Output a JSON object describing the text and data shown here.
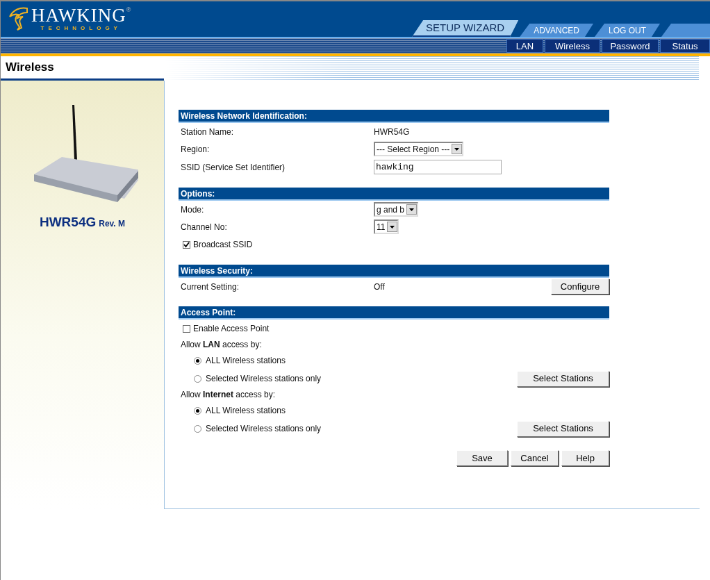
{
  "logo": {
    "name": "HAWKING",
    "mark": "®",
    "tagline": "TECHNOLOGY"
  },
  "main_tabs": [
    {
      "label": "SETUP WIZARD",
      "selected": true
    },
    {
      "label": "ADVANCED",
      "selected": false
    },
    {
      "label": "LOG OUT",
      "selected": false
    }
  ],
  "sub_nav": [
    "LAN",
    "Wireless",
    "Password",
    "Status"
  ],
  "page_title": "Wireless",
  "product": {
    "model": "HWR54G",
    "revision": "Rev. M"
  },
  "sections": [
    {
      "title": "Wireless Network Identification:",
      "rows": [
        {
          "kind": "text",
          "label": "Station Name:",
          "value": "HWR54G"
        },
        {
          "kind": "select",
          "label": "Region:",
          "value": "--- Select Region ---"
        },
        {
          "kind": "input",
          "label": "SSID (Service Set Identifier)",
          "value": "hawking"
        }
      ]
    },
    {
      "title": "Options:",
      "rows": [
        {
          "kind": "select",
          "label": "Mode:",
          "value": "g and b"
        },
        {
          "kind": "select",
          "label": "Channel No:",
          "value": "11"
        },
        {
          "kind": "checkbox",
          "label": "Broadcast SSID",
          "checked": true
        }
      ]
    },
    {
      "title": "Wireless Security:",
      "rows": [
        {
          "kind": "text",
          "label": "Current Setting:",
          "value": "Off",
          "button": "Configure"
        }
      ]
    },
    {
      "title": "Access Point:",
      "rows": [
        {
          "kind": "checkbox",
          "label": "Enable Access Point",
          "checked": false
        },
        {
          "kind": "label",
          "label": "Allow **LAN** access by:"
        },
        {
          "kind": "radio",
          "label": "ALL Wireless stations",
          "selected": true
        },
        {
          "kind": "radio",
          "label": "Selected Wireless stations only",
          "selected": false,
          "button": "Select Stations"
        },
        {
          "kind": "label",
          "label": "Allow **Internet** access by:"
        },
        {
          "kind": "radio",
          "label": "ALL Wireless stations",
          "selected": true
        },
        {
          "kind": "radio",
          "label": "Selected Wireless stations only",
          "selected": false,
          "button": "Select Stations"
        }
      ]
    }
  ],
  "actions": [
    "Save",
    "Cancel",
    "Help"
  ]
}
